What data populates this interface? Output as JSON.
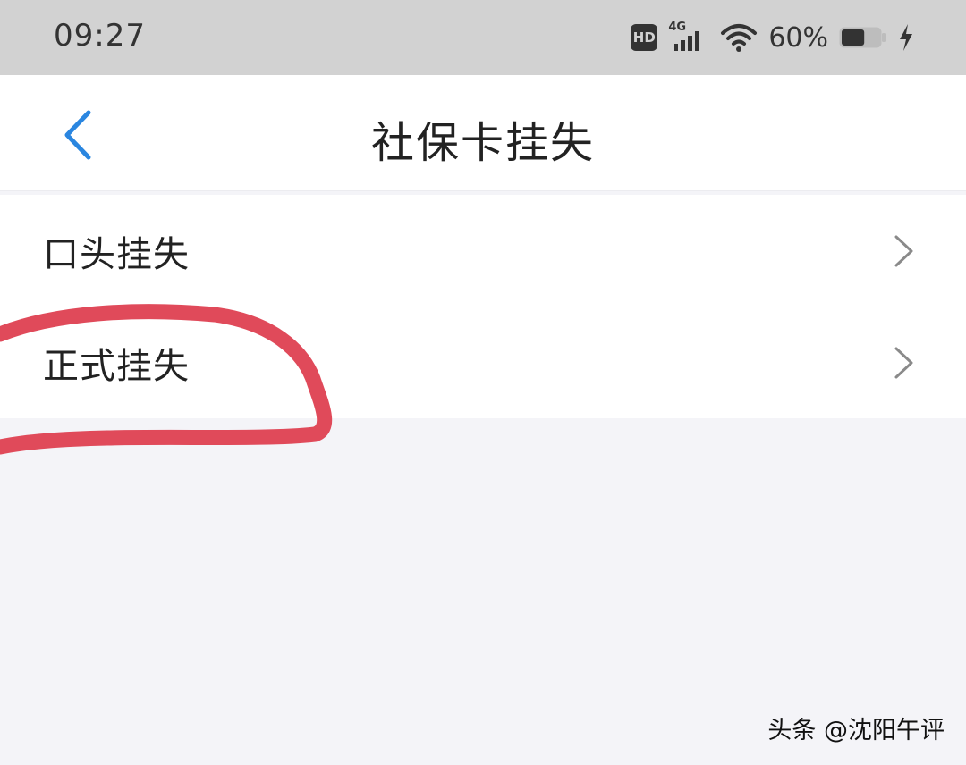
{
  "status_bar": {
    "time": "09:27",
    "hd_label": "HD",
    "network_label": "4G",
    "battery_percent": "60%",
    "battery_level": 0.6,
    "icons": [
      "hd-icon",
      "signal-icon",
      "wifi-icon",
      "battery-icon",
      "charging-icon"
    ]
  },
  "nav": {
    "title": "社保卡挂失",
    "back_icon": "chevron-left-icon",
    "accent_color": "#2a86e0"
  },
  "list": {
    "items": [
      {
        "label": "口头挂失",
        "icon": "chevron-right-icon"
      },
      {
        "label": "正式挂失",
        "icon": "chevron-right-icon"
      }
    ]
  },
  "annotation": {
    "color": "#e04a5a"
  },
  "watermark": {
    "text": "头条 @沈阳午评"
  }
}
